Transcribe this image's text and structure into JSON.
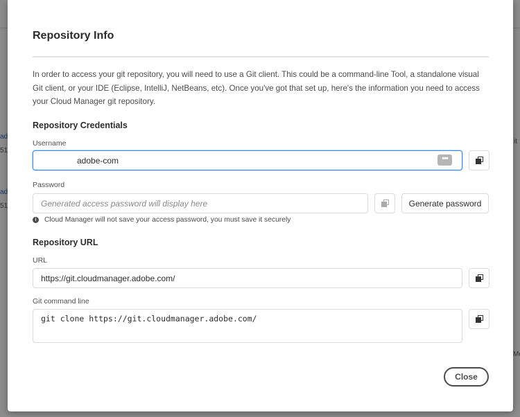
{
  "background": {
    "frag1": "adc",
    "frag2": "51",
    "frag3": "adc",
    "frag4": "51",
    "frag5": "it",
    "frag6": "Mo"
  },
  "modal": {
    "title": "Repository Info",
    "intro": "In order to access your git repository, you will need to use a Git client. This could be a command-line Tool, a standalone visual Git client, or your IDE (Eclipse, IntelliJ, NetBeans, etc). Once you've got that set up, here's the information you need to access your Cloud Manager git repository.",
    "credentials": {
      "heading": "Repository Credentials",
      "username_label": "Username",
      "username_value": "adobe-com",
      "password_label": "Password",
      "password_placeholder": "Generated access password will display here",
      "generate_label": "Generate password",
      "note": "Cloud Manager will not save your access password, you must save it securely"
    },
    "url_section": {
      "heading": "Repository URL",
      "url_label": "URL",
      "url_value": "https://git.cloudmanager.adobe.com/",
      "cmd_label": "Git command line",
      "cmd_value": "git clone https://git.cloudmanager.adobe.com/"
    },
    "close_label": "Close"
  },
  "colors": {
    "focus": "#378ef0",
    "text": "#2c2c2c"
  }
}
